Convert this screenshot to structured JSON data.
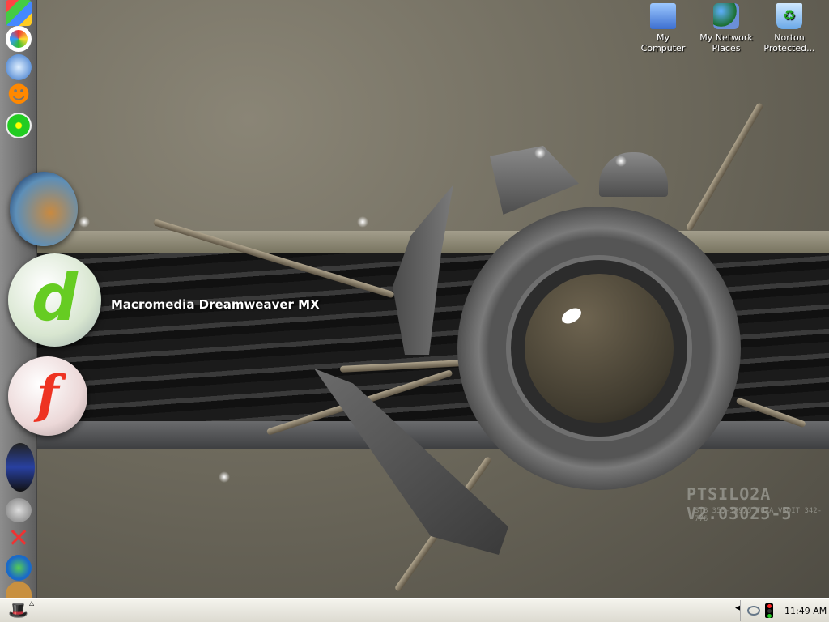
{
  "desktop": {
    "icons": [
      {
        "label_1": "My",
        "label_2": "Computer",
        "icon": "my-computer-icon"
      },
      {
        "label_1": "My Network",
        "label_2": "Places",
        "icon": "network-places-icon"
      },
      {
        "label_1": "Norton",
        "label_2": "Protected...",
        "icon": "recycle-bin-icon"
      }
    ],
    "wallpaper_text": "PTSILO2A V2.03025-5",
    "wallpaper_subtext": "STB 353-35975 TUXA VSOIT 342-776"
  },
  "dock": {
    "small_icons_top": [
      "windows-update-icon",
      "media-player-icon",
      "outlook-express-icon",
      "aim-icon",
      "icq-icon"
    ],
    "large_icons": [
      "photoshop-icon",
      "dreamweaver-icon",
      "flash-icon"
    ],
    "hover_label": "Macromedia Dreamweaver MX",
    "small_icons_bottom": [
      "video-icon",
      "dvd-icon",
      "x-icon",
      "messenger-icon",
      "cookie-icon"
    ]
  },
  "taskbar": {
    "start_icon": "redhat-icon",
    "clock": "11:49 AM",
    "tray_icons": [
      "network-icon",
      "traffic-light-icon"
    ]
  }
}
